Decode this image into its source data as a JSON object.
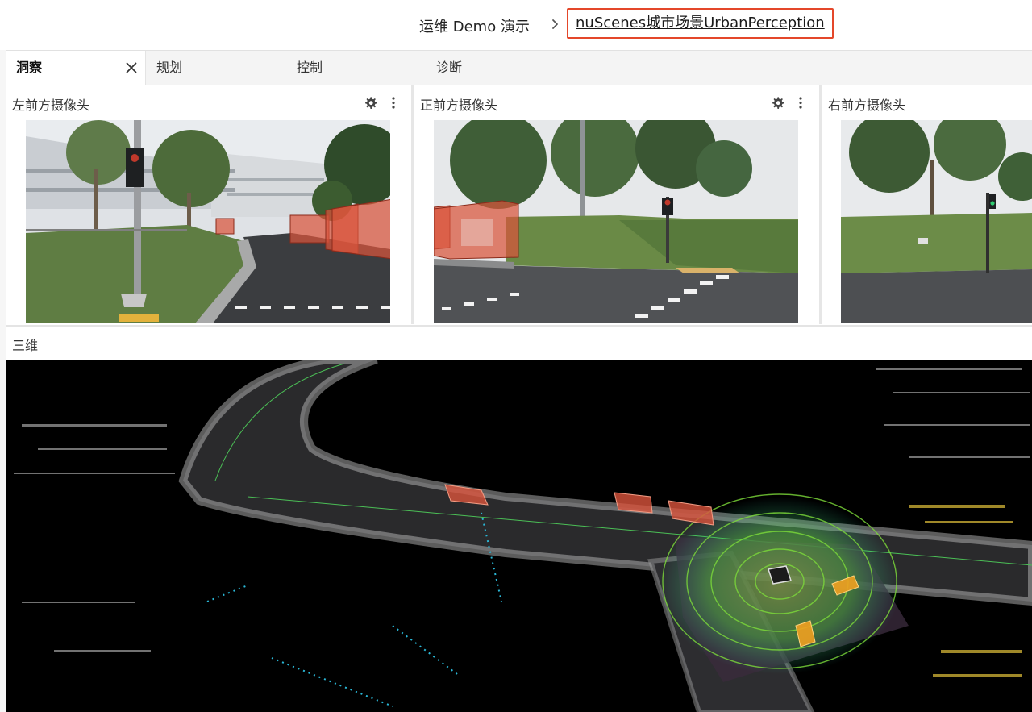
{
  "header": {
    "workspace_label": "运维 Demo 演示",
    "current_project": "nuScenes城市场景UrbanPerception"
  },
  "tabs": [
    {
      "label": "洞察",
      "active": true
    },
    {
      "label": "规划",
      "active": false
    },
    {
      "label": "控制",
      "active": false
    },
    {
      "label": "诊断",
      "active": false
    }
  ],
  "camera_panels": [
    {
      "title": "左前方摄像头"
    },
    {
      "title": "正前方摄像头"
    },
    {
      "title": "右前方摄像头"
    }
  ],
  "viewer3d": {
    "title": "三维"
  },
  "colors": {
    "highlight_border": "#e4472a",
    "bbox_fill": "#d9543c",
    "lidar_near": "#7ddc3a",
    "lidar_far": "#2ab7d6",
    "vehicle_box": "#f0a020"
  },
  "icons": [
    "chevron-right-icon",
    "close-icon",
    "gear-icon",
    "more-vertical-icon"
  ]
}
